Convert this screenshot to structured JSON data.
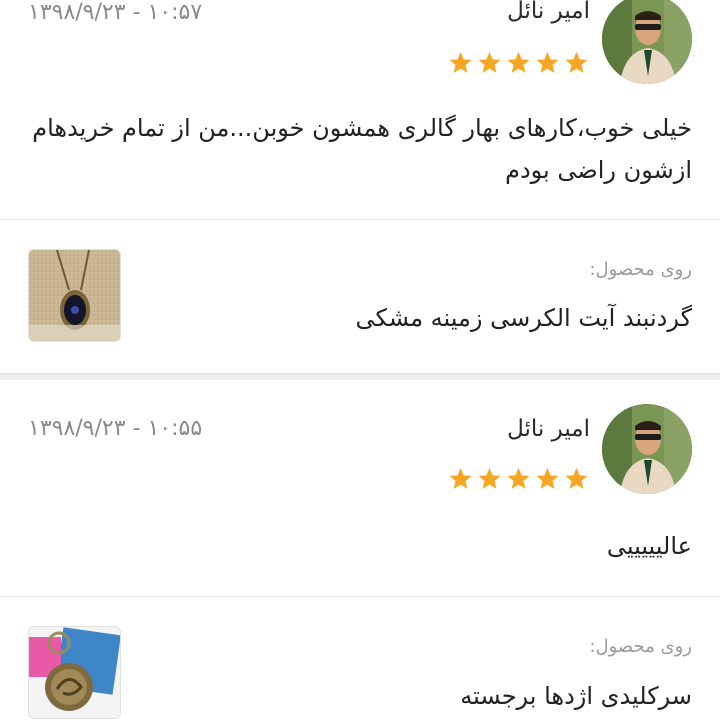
{
  "reviews": [
    {
      "author": "امیر نائل",
      "datetime": "۱۳۹۸/۹/۲۳ - ۱۰:۵۷",
      "rating": 5,
      "comment": "خیلی خوب،کارهای بهار گالری همشون خوبن...من از تمام خریدهام ازشون راضی بودم",
      "on_product_label": "روی محصول:",
      "product_name": "گردنبند آیت الکرسی زمینه مشکی",
      "avatar_icon": "user-avatar-photo",
      "product_icon": "necklace-pendant-photo"
    },
    {
      "author": "امیر نائل",
      "datetime": "۱۳۹۸/۹/۲۳ - ۱۰:۵۵",
      "rating": 5,
      "comment": "عالیییییی",
      "on_product_label": "روی محصول:",
      "product_name": "سرکلیدی اژدها برجسته",
      "avatar_icon": "user-avatar-photo",
      "product_icon": "dragon-keychain-photo"
    }
  ],
  "colors": {
    "star": "#f5a623",
    "muted_text": "#8a8a8a",
    "background": "#efefef",
    "card": "#ffffff"
  }
}
